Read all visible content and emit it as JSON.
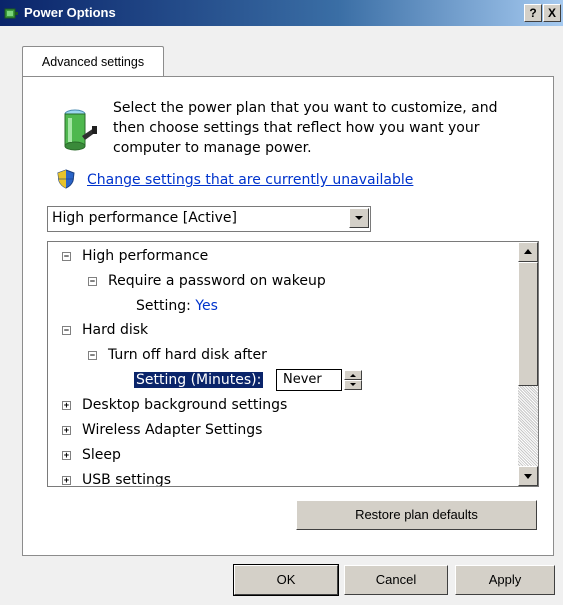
{
  "window": {
    "title": "Power Options",
    "help_btn": "?",
    "close_btn": "X"
  },
  "tabs": [
    {
      "label": "Advanced settings"
    }
  ],
  "description": "Select the power plan that you want to customize, and then choose settings that reflect how you want your computer to manage power.",
  "change_link": "Change settings that are currently unavailable",
  "plan_combo": {
    "selected": "High performance [Active]"
  },
  "tree": {
    "high_performance": "High performance",
    "require_password": "Require a password on wakeup",
    "setting_label": "Setting:",
    "setting_value": "Yes",
    "hard_disk": "Hard disk",
    "turn_off_hd": "Turn off hard disk after",
    "setting_minutes_label": "Setting (Minutes):",
    "minutes_value": "Never",
    "desktop_bg": "Desktop background settings",
    "wireless": "Wireless Adapter Settings",
    "sleep": "Sleep",
    "usb": "USB settings"
  },
  "buttons": {
    "restore": "Restore plan defaults",
    "ok": "OK",
    "cancel": "Cancel",
    "apply": "Apply"
  },
  "icons": {
    "title_icon": "power-options-icon",
    "battery_icon": "battery-plug-icon",
    "shield_icon": "uac-shield-icon"
  }
}
